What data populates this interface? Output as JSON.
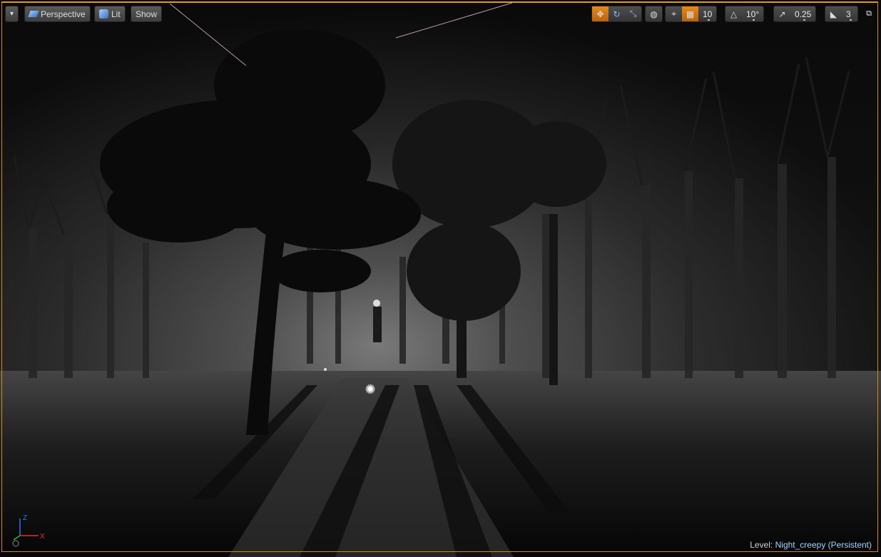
{
  "toolbar_left": {
    "dropdown_glyph": "▾",
    "view_mode": "Perspective",
    "lighting": "Lit",
    "show": "Show"
  },
  "toolbar_right": {
    "grid_snap_value": "10",
    "rotation_snap_value": "10°",
    "scale_snap_value": "0.25",
    "camera_speed_value": "3"
  },
  "status": {
    "level_label": "Level:",
    "level_name": "Night_creepy (Persistent)"
  },
  "axis_gizmo": {
    "z": "Z",
    "x": "X"
  },
  "colors": {
    "active_orange": "#e58a1c",
    "border_orange": "#d08a1a",
    "level_name_blue": "#9fd4ff"
  },
  "icons": [
    "dropdown-arrow-icon",
    "perspective-cube-icon",
    "lit-sphere-icon",
    "translate-icon",
    "rotate-icon",
    "scale-icon",
    "world-local-icon",
    "surface-snap-icon",
    "grid-snap-icon",
    "rotation-snap-icon",
    "scale-snap-icon",
    "camera-speed-icon",
    "maximize-icon",
    "directional-light-icon"
  ]
}
